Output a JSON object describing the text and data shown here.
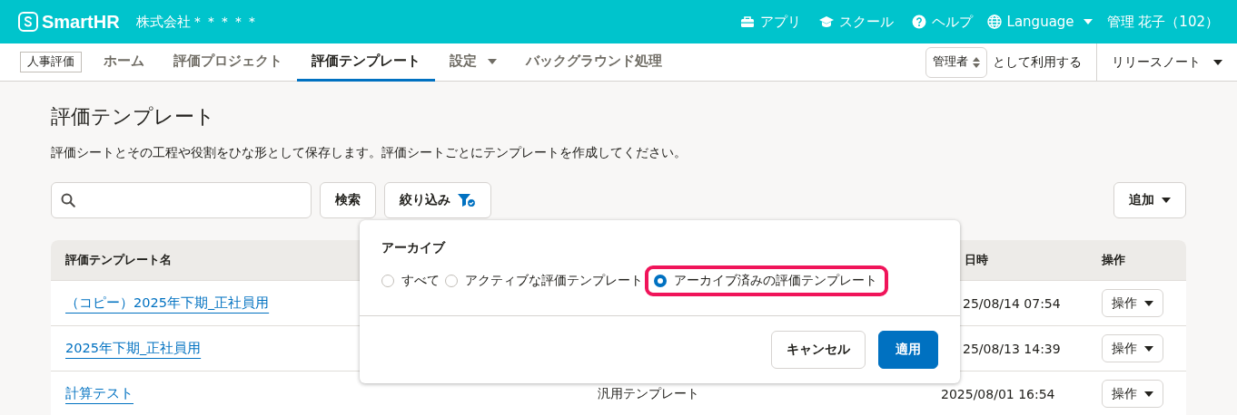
{
  "header": {
    "logo": "SmartHR",
    "company": "株式会社＊＊＊＊＊",
    "links": [
      {
        "kind": "app",
        "label": "アプリ"
      },
      {
        "kind": "school",
        "label": "スクール"
      },
      {
        "kind": "help",
        "label": "ヘルプ"
      },
      {
        "kind": "language",
        "label": "Language"
      }
    ],
    "user": "管理 花子（102）"
  },
  "subnav": {
    "app_badge": "人事評価",
    "tabs": [
      {
        "label": "ホーム",
        "selected": false,
        "dropdown": false
      },
      {
        "label": "評価プロジェクト",
        "selected": false,
        "dropdown": false
      },
      {
        "label": "評価テンプレート",
        "selected": true,
        "dropdown": false
      },
      {
        "label": "設定",
        "selected": false,
        "dropdown": true
      },
      {
        "label": "バックグラウンド処理",
        "selected": false,
        "dropdown": false
      }
    ],
    "role": "管理者",
    "role_suffix": "として利用する",
    "release_notes": "リリースノート"
  },
  "page": {
    "title": "評価テンプレート",
    "description": "評価シートとその工程や役割をひな形として保存します。評価シートごとにテンプレートを作成してください。"
  },
  "toolbar": {
    "search_button": "検索",
    "filter_button": "絞り込み",
    "filter_active": true,
    "add_button": "追加"
  },
  "table": {
    "columns": [
      "評価テンプレート名",
      "日時",
      "操作"
    ],
    "rows": [
      {
        "name": "（コピー）2025年下期_正社員用",
        "date": "25/08/14 07:54",
        "action": "操作"
      },
      {
        "name": "2025年下期_正社員用",
        "date": "25/08/13 14:39",
        "action": "操作"
      },
      {
        "name": "計算テスト",
        "type": "汎用テンプレート",
        "date": "2025/08/01 16:54",
        "action": "操作"
      }
    ]
  },
  "filter_popover": {
    "title": "アーカイブ",
    "options": [
      {
        "label": "すべて",
        "selected": false,
        "highlighted": false
      },
      {
        "label": "アクティブな評価テンプレート",
        "selected": false,
        "highlighted": false
      },
      {
        "label": "アーカイブ済みの評価テンプレート",
        "selected": true,
        "highlighted": true
      }
    ],
    "cancel": "キャンセル",
    "apply": "適用"
  }
}
